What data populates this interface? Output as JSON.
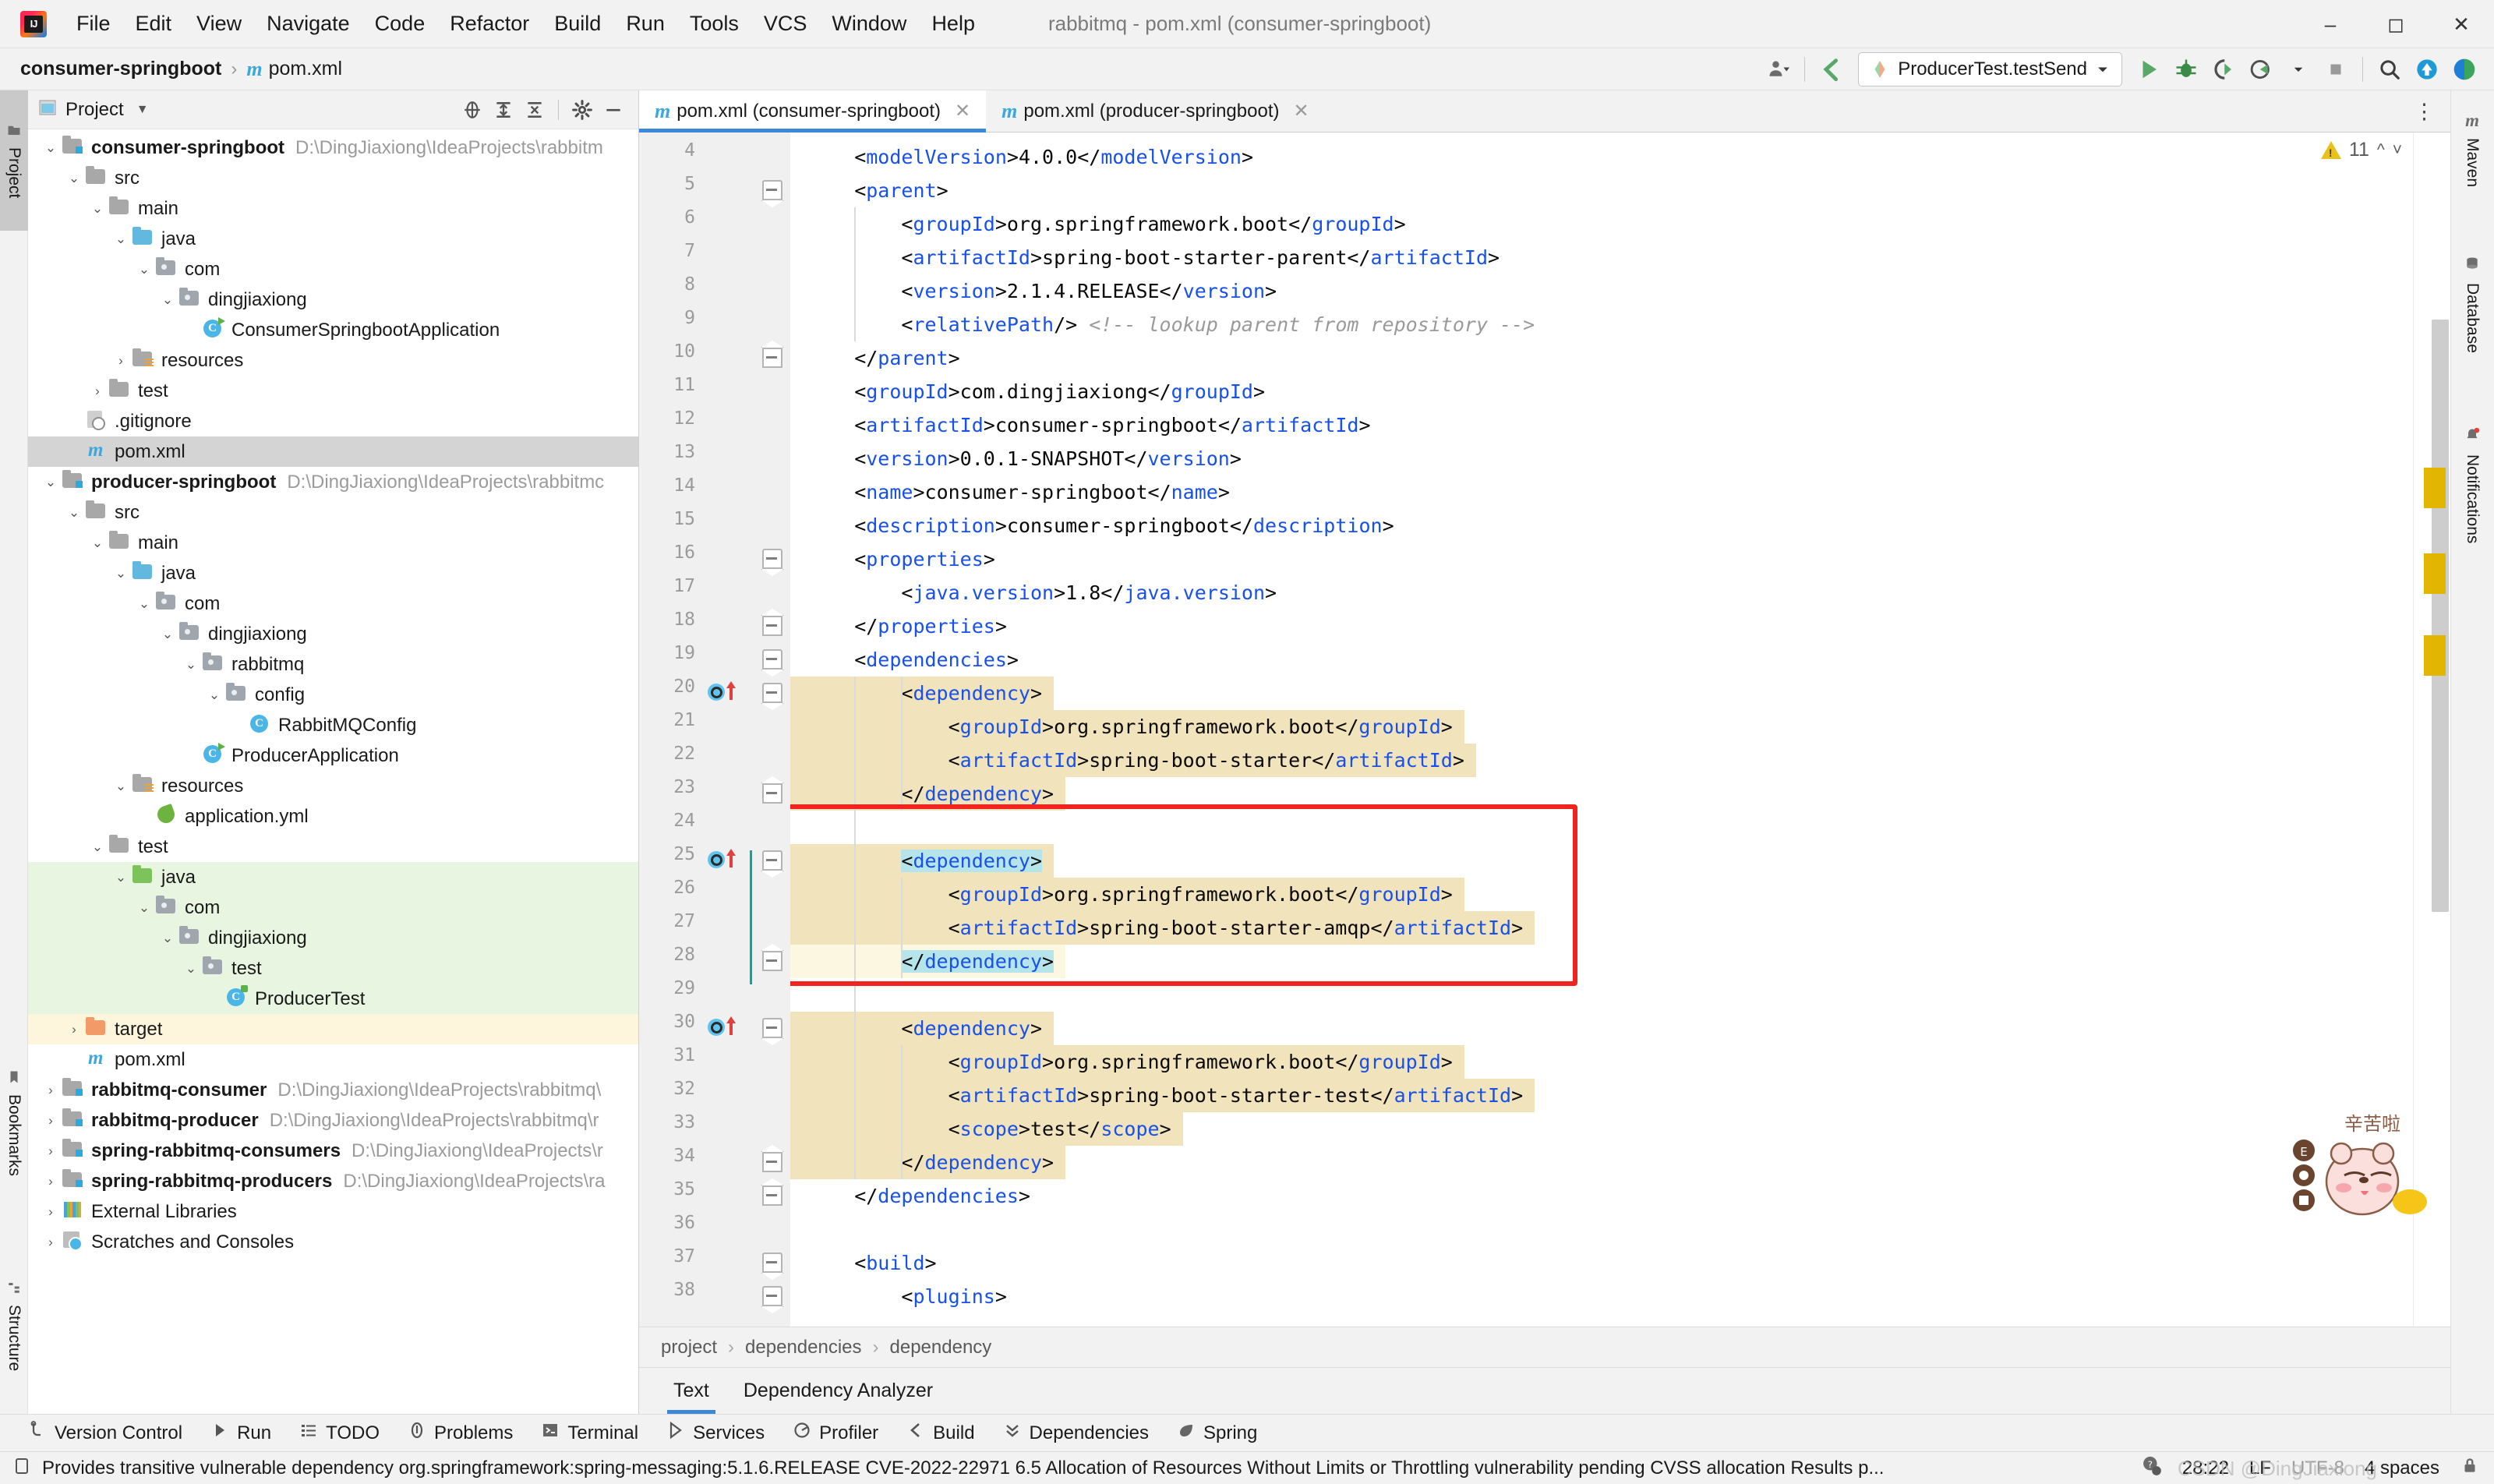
{
  "window": {
    "title": "rabbitmq - pom.xml (consumer-springboot)",
    "logo_icon": "intellij-idea-logo",
    "minimize_icon": "minimize-icon",
    "maximize_icon": "maximize-icon",
    "close_icon": "close-icon"
  },
  "menu": [
    "File",
    "Edit",
    "View",
    "Navigate",
    "Code",
    "Refactor",
    "Build",
    "Run",
    "Tools",
    "VCS",
    "Window",
    "Help"
  ],
  "navbar": {
    "crumbs": [
      "consumer-springboot",
      "pom.xml"
    ],
    "separator": "›",
    "file_icon": "maven-m-icon",
    "right": {
      "user_icon": "user-avatar-icon",
      "updates_icon": "update-arrow-icon",
      "run_config": "ProducerTest.testSend",
      "run_config_icon": "run-config-icon",
      "dropdown_icon": "chevron-down-icon",
      "run_icon": "run-icon",
      "debug_icon": "debug-icon",
      "run_coverage_icon": "run-with-coverage-icon",
      "profile_icon": "profiler-icon",
      "stop_icon": "stop-icon",
      "search_icon": "search-everywhere-icon",
      "updates_badge_icon": "ide-update-icon",
      "ai_icon": "ai-assistant-icon"
    }
  },
  "left_strip": [
    {
      "label": "Project",
      "icon": "project-tool-icon",
      "selected": true
    },
    {
      "label": "Bookmarks",
      "icon": "bookmarks-icon",
      "selected": false
    },
    {
      "label": "Structure",
      "icon": "structure-icon",
      "selected": false
    }
  ],
  "right_strip": [
    {
      "label": "Maven",
      "icon": "maven-m-icon"
    },
    {
      "label": "Database",
      "icon": "database-icon"
    },
    {
      "label": "Notifications",
      "icon": "notifications-bell-icon"
    }
  ],
  "project_panel": {
    "title": "Project",
    "dropdown_icon": "chevron-down-icon",
    "locate_icon": "select-opened-file-icon",
    "expand_icon": "expand-all-icon",
    "collapse_icon": "collapse-all-icon",
    "settings_icon": "gear-icon",
    "hide_icon": "hide-icon",
    "tree": [
      {
        "depth": 0,
        "label": "consumer-springboot",
        "path": "D:\\DingJiaxiong\\IdeaProjects\\rabbitm",
        "icon": "module-folder-icon",
        "arrow": "expanded",
        "bold": true,
        "row": "normal"
      },
      {
        "depth": 1,
        "label": "src",
        "path": "",
        "icon": "folder-icon",
        "arrow": "expanded",
        "bold": false,
        "row": "normal"
      },
      {
        "depth": 2,
        "label": "main",
        "path": "",
        "icon": "folder-icon",
        "arrow": "expanded",
        "bold": false,
        "row": "normal"
      },
      {
        "depth": 3,
        "label": "java",
        "path": "",
        "icon": "source-root-folder-icon",
        "arrow": "expanded",
        "bold": false,
        "row": "normal"
      },
      {
        "depth": 4,
        "label": "com",
        "path": "",
        "icon": "package-icon",
        "arrow": "expanded",
        "bold": false,
        "row": "normal"
      },
      {
        "depth": 5,
        "label": "dingjiaxiong",
        "path": "",
        "icon": "package-icon",
        "arrow": "expanded",
        "bold": false,
        "row": "normal"
      },
      {
        "depth": 6,
        "label": "ConsumerSpringbootApplication",
        "path": "",
        "icon": "spring-boot-class-icon",
        "arrow": "none",
        "bold": false,
        "row": "normal"
      },
      {
        "depth": 3,
        "label": "resources",
        "path": "",
        "icon": "resources-folder-icon",
        "arrow": "collapsed",
        "bold": false,
        "row": "normal"
      },
      {
        "depth": 2,
        "label": "test",
        "path": "",
        "icon": "folder-icon",
        "arrow": "collapsed",
        "bold": false,
        "row": "normal"
      },
      {
        "depth": 1,
        "label": ".gitignore",
        "path": "",
        "icon": "gitignore-file-icon",
        "arrow": "none",
        "bold": false,
        "row": "normal"
      },
      {
        "depth": 1,
        "label": "pom.xml",
        "path": "",
        "icon": "maven-m-icon",
        "arrow": "none",
        "bold": false,
        "row": "selected"
      },
      {
        "depth": 0,
        "label": "producer-springboot",
        "path": "D:\\DingJiaxiong\\IdeaProjects\\rabbitmc",
        "icon": "module-folder-icon",
        "arrow": "expanded",
        "bold": true,
        "row": "normal"
      },
      {
        "depth": 1,
        "label": "src",
        "path": "",
        "icon": "folder-icon",
        "arrow": "expanded",
        "bold": false,
        "row": "normal"
      },
      {
        "depth": 2,
        "label": "main",
        "path": "",
        "icon": "folder-icon",
        "arrow": "expanded",
        "bold": false,
        "row": "normal"
      },
      {
        "depth": 3,
        "label": "java",
        "path": "",
        "icon": "source-root-folder-icon",
        "arrow": "expanded",
        "bold": false,
        "row": "normal"
      },
      {
        "depth": 4,
        "label": "com",
        "path": "",
        "icon": "package-icon",
        "arrow": "expanded",
        "bold": false,
        "row": "normal"
      },
      {
        "depth": 5,
        "label": "dingjiaxiong",
        "path": "",
        "icon": "package-icon",
        "arrow": "expanded",
        "bold": false,
        "row": "normal"
      },
      {
        "depth": 6,
        "label": "rabbitmq",
        "path": "",
        "icon": "package-icon",
        "arrow": "expanded",
        "bold": false,
        "row": "normal"
      },
      {
        "depth": 7,
        "label": "config",
        "path": "",
        "icon": "package-icon",
        "arrow": "expanded",
        "bold": false,
        "row": "normal"
      },
      {
        "depth": 8,
        "label": "RabbitMQConfig",
        "path": "",
        "icon": "java-class-icon",
        "arrow": "none",
        "bold": false,
        "row": "normal"
      },
      {
        "depth": 6,
        "label": "ProducerApplication",
        "path": "",
        "icon": "spring-boot-class-icon",
        "arrow": "none",
        "bold": false,
        "row": "normal"
      },
      {
        "depth": 3,
        "label": "resources",
        "path": "",
        "icon": "resources-folder-icon",
        "arrow": "expanded",
        "bold": false,
        "row": "normal"
      },
      {
        "depth": 4,
        "label": "application.yml",
        "path": "",
        "icon": "spring-yaml-icon",
        "arrow": "none",
        "bold": false,
        "row": "normal"
      },
      {
        "depth": 2,
        "label": "test",
        "path": "",
        "icon": "folder-icon",
        "arrow": "expanded",
        "bold": false,
        "row": "normal"
      },
      {
        "depth": 3,
        "label": "java",
        "path": "",
        "icon": "test-source-root-folder-icon",
        "arrow": "expanded",
        "bold": false,
        "row": "green"
      },
      {
        "depth": 4,
        "label": "com",
        "path": "",
        "icon": "package-icon",
        "arrow": "expanded",
        "bold": false,
        "row": "green"
      },
      {
        "depth": 5,
        "label": "dingjiaxiong",
        "path": "",
        "icon": "package-icon",
        "arrow": "expanded",
        "bold": false,
        "row": "green"
      },
      {
        "depth": 6,
        "label": "test",
        "path": "",
        "icon": "package-icon",
        "arrow": "expanded",
        "bold": false,
        "row": "green"
      },
      {
        "depth": 7,
        "label": "ProducerTest",
        "path": "",
        "icon": "test-class-icon",
        "arrow": "none",
        "bold": false,
        "row": "green"
      },
      {
        "depth": 1,
        "label": "target",
        "path": "",
        "icon": "excluded-folder-icon",
        "arrow": "collapsed",
        "bold": false,
        "row": "yellow"
      },
      {
        "depth": 1,
        "label": "pom.xml",
        "path": "",
        "icon": "maven-m-icon",
        "arrow": "none",
        "bold": false,
        "row": "normal"
      },
      {
        "depth": 0,
        "label": "rabbitmq-consumer",
        "path": "D:\\DingJiaxiong\\IdeaProjects\\rabbitmq\\",
        "icon": "module-folder-icon",
        "arrow": "collapsed",
        "bold": true,
        "row": "normal"
      },
      {
        "depth": 0,
        "label": "rabbitmq-producer",
        "path": "D:\\DingJiaxiong\\IdeaProjects\\rabbitmq\\r",
        "icon": "module-folder-icon",
        "arrow": "collapsed",
        "bold": true,
        "row": "normal"
      },
      {
        "depth": 0,
        "label": "spring-rabbitmq-consumers",
        "path": "D:\\DingJiaxiong\\IdeaProjects\\r",
        "icon": "module-folder-icon",
        "arrow": "collapsed",
        "bold": true,
        "row": "normal"
      },
      {
        "depth": 0,
        "label": "spring-rabbitmq-producers",
        "path": "D:\\DingJiaxiong\\IdeaProjects\\ra",
        "icon": "module-folder-icon",
        "arrow": "collapsed",
        "bold": true,
        "row": "normal"
      },
      {
        "depth": 0,
        "label": "External Libraries",
        "path": "",
        "icon": "external-libraries-icon",
        "arrow": "collapsed",
        "bold": false,
        "row": "normal"
      },
      {
        "depth": 0,
        "label": "Scratches and Consoles",
        "path": "",
        "icon": "scratches-icon",
        "arrow": "collapsed",
        "bold": false,
        "row": "normal"
      }
    ]
  },
  "editor": {
    "tabs": [
      {
        "label": "pom.xml (producer-springboot)",
        "icon": "maven-m-icon",
        "active": false,
        "close_icon": "close-icon"
      },
      {
        "label": "pom.xml (consumer-springboot)",
        "icon": "maven-m-icon",
        "active": true,
        "close_icon": "close-icon"
      }
    ],
    "options_icon": "more-options-icon",
    "inspection_count": "11",
    "inspection_icon": "warning-triangle-icon",
    "inspection_prev_icon": "chevron-up-icon",
    "inspection_next_icon": "chevron-down-icon",
    "first_line": 4,
    "lines": [
      {
        "n": 4,
        "indent": 1,
        "text": "<modelVersion>4.0.0</modelVersion>",
        "hl": "none"
      },
      {
        "n": 5,
        "indent": 1,
        "text": "<parent>",
        "hl": "none"
      },
      {
        "n": 6,
        "indent": 2,
        "text": "<groupId>org.springframework.boot</groupId>",
        "hl": "none"
      },
      {
        "n": 7,
        "indent": 2,
        "text": "<artifactId>spring-boot-starter-parent</artifactId>",
        "hl": "none"
      },
      {
        "n": 8,
        "indent": 2,
        "text": "<version>2.1.4.RELEASE</version>",
        "hl": "none"
      },
      {
        "n": 9,
        "indent": 2,
        "text": "<relativePath/> <!-- lookup parent from repository -->",
        "hl": "none"
      },
      {
        "n": 10,
        "indent": 1,
        "text": "</parent>",
        "hl": "none"
      },
      {
        "n": 11,
        "indent": 1,
        "text": "<groupId>com.dingjiaxiong</groupId>",
        "hl": "none"
      },
      {
        "n": 12,
        "indent": 1,
        "text": "<artifactId>consumer-springboot</artifactId>",
        "hl": "none"
      },
      {
        "n": 13,
        "indent": 1,
        "text": "<version>0.0.1-SNAPSHOT</version>",
        "hl": "none"
      },
      {
        "n": 14,
        "indent": 1,
        "text": "<name>consumer-springboot</name>",
        "hl": "none"
      },
      {
        "n": 15,
        "indent": 1,
        "text": "<description>consumer-springboot</description>",
        "hl": "none"
      },
      {
        "n": 16,
        "indent": 1,
        "text": "<properties>",
        "hl": "none"
      },
      {
        "n": 17,
        "indent": 2,
        "text": "<java.version>1.8</java.version>",
        "hl": "none"
      },
      {
        "n": 18,
        "indent": 1,
        "text": "</properties>",
        "hl": "none"
      },
      {
        "n": 19,
        "indent": 1,
        "text": "<dependencies>",
        "hl": "none"
      },
      {
        "n": 20,
        "indent": 2,
        "text": "<dependency>",
        "hl": "yellow"
      },
      {
        "n": 21,
        "indent": 3,
        "text": "<groupId>org.springframework.boot</groupId>",
        "hl": "yellow"
      },
      {
        "n": 22,
        "indent": 3,
        "text": "<artifactId>spring-boot-starter</artifactId>",
        "hl": "yellow"
      },
      {
        "n": 23,
        "indent": 2,
        "text": "</dependency>",
        "hl": "yellow"
      },
      {
        "n": 24,
        "indent": 0,
        "text": "",
        "hl": "none"
      },
      {
        "n": 25,
        "indent": 2,
        "text": "<dependency>",
        "hl": "yellow-sel"
      },
      {
        "n": 26,
        "indent": 3,
        "text": "<groupId>org.springframework.boot</groupId>",
        "hl": "yellow"
      },
      {
        "n": 27,
        "indent": 3,
        "text": "<artifactId>spring-boot-starter-amqp</artifactId>",
        "hl": "yellow"
      },
      {
        "n": 28,
        "indent": 2,
        "text": "</dependency>",
        "hl": "yellow-sel-caret"
      },
      {
        "n": 29,
        "indent": 0,
        "text": "",
        "hl": "none"
      },
      {
        "n": 30,
        "indent": 2,
        "text": "<dependency>",
        "hl": "yellow"
      },
      {
        "n": 31,
        "indent": 3,
        "text": "<groupId>org.springframework.boot</groupId>",
        "hl": "yellow"
      },
      {
        "n": 32,
        "indent": 3,
        "text": "<artifactId>spring-boot-starter-test</artifactId>",
        "hl": "yellow"
      },
      {
        "n": 33,
        "indent": 3,
        "text": "<scope>test</scope>",
        "hl": "yellow"
      },
      {
        "n": 34,
        "indent": 2,
        "text": "</dependency>",
        "hl": "yellow"
      },
      {
        "n": 35,
        "indent": 1,
        "text": "</dependencies>",
        "hl": "none"
      },
      {
        "n": 36,
        "indent": 0,
        "text": "",
        "hl": "none"
      },
      {
        "n": 37,
        "indent": 1,
        "text": "<build>",
        "hl": "none"
      },
      {
        "n": 38,
        "indent": 2,
        "text": "<plugins>",
        "hl": "none"
      }
    ],
    "gutter_bean_lines": [
      20,
      25,
      30
    ],
    "gutter_bean_icon": "spring-bean-icon",
    "gutter_arrow_icon": "navigate-up-arrow-icon",
    "fold_top_lines": [
      5,
      16,
      19,
      20,
      25,
      30,
      37,
      38
    ],
    "fold_bottom_lines": [
      10,
      18,
      23,
      28,
      34,
      35
    ],
    "red_highlight_box": {
      "from_line": 24,
      "to_line": 29,
      "color": "#f0231f"
    },
    "breadcrumbs": [
      "project",
      "dependencies",
      "dependency"
    ],
    "breadcrumb_sep": "›",
    "bottom_tabs": [
      {
        "label": "Text",
        "active": true
      },
      {
        "label": "Dependency Analyzer",
        "active": false
      }
    ]
  },
  "bottom_bar": [
    {
      "label": "Version Control",
      "icon": "version-control-icon"
    },
    {
      "label": "Run",
      "icon": "run-icon"
    },
    {
      "label": "TODO",
      "icon": "todo-list-icon"
    },
    {
      "label": "Problems",
      "icon": "problems-icon"
    },
    {
      "label": "Terminal",
      "icon": "terminal-icon"
    },
    {
      "label": "Services",
      "icon": "services-icon"
    },
    {
      "label": "Profiler",
      "icon": "profiler-icon"
    },
    {
      "label": "Build",
      "icon": "build-icon"
    },
    {
      "label": "Dependencies",
      "icon": "dependencies-icon"
    },
    {
      "label": "Spring",
      "icon": "spring-leaf-icon"
    }
  ],
  "status_bar": {
    "icon": "inspection-status-icon",
    "message": "Provides transitive vulnerable dependency org.springframework:spring-messaging:5.1.6.RELEASE CVE-2022-22971 6.5 Allocation of Resources Without Limits or Throttling vulnerability pending CVSS allocation  Results p...",
    "help_icon": "help-icon",
    "caret_position": "28:22",
    "line_separator": "LF",
    "encoding": "UTF-8",
    "indent": "4 spaces",
    "lock_icon": "read-only-lock-icon"
  },
  "watermarks": {
    "sticker_text": "辛苦啦",
    "csdn_text": "CSDN @DingJiaxiong"
  },
  "colors": {
    "accent": "#3d87d8",
    "tag": "#1750eb",
    "highlight_yellow": "#f1e3bb",
    "selection_cyan": "#b5e4ea",
    "red_box": "#f0231f",
    "green_row": "#e8f5e0",
    "yellow_row": "#fdf6dd",
    "marker_yellow": "#e2b600"
  }
}
